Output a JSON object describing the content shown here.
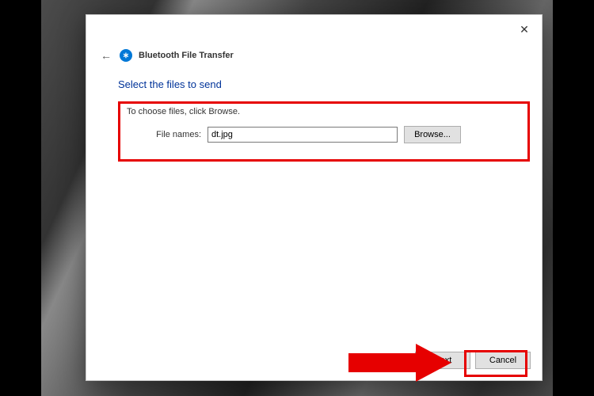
{
  "window": {
    "title": "Bluetooth File Transfer",
    "subtitle": "Select the files to send",
    "close_label": "✕"
  },
  "content": {
    "instruction": "To choose files, click Browse.",
    "file_label": "File names:",
    "file_value": "dt.jpg",
    "browse_label": "Browse..."
  },
  "footer": {
    "next_label": "Next",
    "cancel_label": "Cancel"
  },
  "icons": {
    "bluetooth_glyph": "∗",
    "back_glyph": "←"
  },
  "annotation": {
    "highlight_color": "#e60000"
  }
}
